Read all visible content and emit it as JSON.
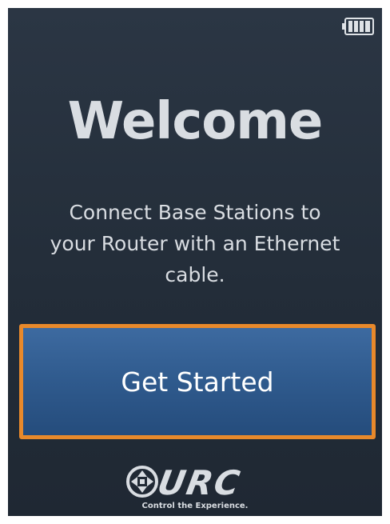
{
  "screen": {
    "title": "Welcome",
    "message_lines": [
      "Connect Base Stations to",
      "your Router with an Ethernet",
      "cable."
    ],
    "battery_level": 1.0
  },
  "cta": {
    "label": "Get Started"
  },
  "brand": {
    "logo_text": "URC",
    "tagline": "Control the Experience."
  },
  "colors": {
    "background": "#232d39",
    "text": "#d9dde2",
    "button": "#2f5a8d",
    "button_border": "#e8892b"
  }
}
